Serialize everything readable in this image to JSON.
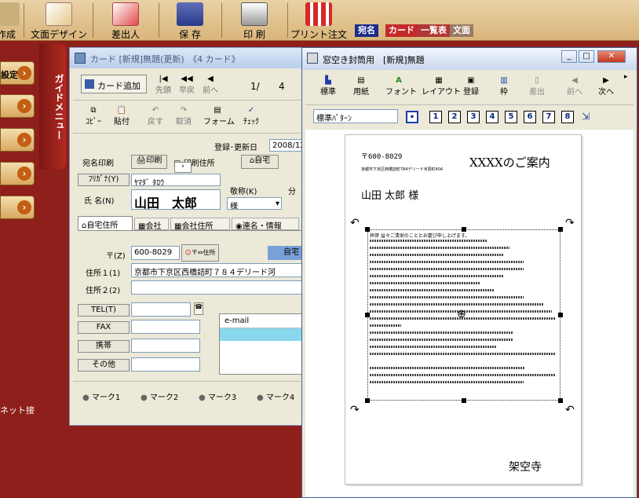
{
  "toolbar": {
    "items": [
      {
        "label": "作成",
        "icon": "create-icon"
      },
      {
        "label": "文面デザイン",
        "icon": "design-icon"
      },
      {
        "label": "差出人",
        "icon": "sender-icon"
      },
      {
        "label": "保 存",
        "icon": "save-icon"
      },
      {
        "label": "印 刷",
        "icon": "printer-icon"
      },
      {
        "label": "プリント注文",
        "icon": "print-order-icon"
      }
    ],
    "tabs": [
      "宛名",
      "カード",
      "一覧表",
      "文面"
    ]
  },
  "sidebar": {
    "items": [
      {
        "label": "設定"
      },
      {
        "label": ""
      },
      {
        "label": ""
      },
      {
        "label": ""
      },
      {
        "label": ""
      }
    ],
    "guide_label": "ガイドメニュー",
    "net_label": "ネット接"
  },
  "card_window": {
    "title": "カード [新規]無題(更新)　《4 カード》",
    "add_card": "カード追加",
    "nav": [
      "先頭",
      "早戻",
      "前へ"
    ],
    "page": "1/",
    "page_total": "4",
    "tools": [
      "ｺﾋﾟｰ",
      "貼付",
      "戻す",
      "取消",
      "フォーム",
      "ﾁｪｯｸ"
    ],
    "updated_label": "登録･更新日",
    "updated_value": "2008/12/",
    "print_label": "宛名印刷",
    "print_btn": "印刷",
    "print_addr_label": "印刷住所",
    "home_btn": "自宅",
    "furigana_label": "ﾌﾘｶﾞﾅ(Y)",
    "furigana_value": "ﾔﾏﾀﾞ ﾀﾛｳ",
    "honorific_label": "敬称(K)",
    "honorific_value": "様",
    "category_label": "分",
    "name_label": "氏 名(N)",
    "name_value": "山田　太郎",
    "tabs": [
      "自宅住所",
      "会社",
      "会社住所",
      "連名・情報"
    ],
    "zip_label": "〒(Z)",
    "zip_value": "600-8029",
    "zip_btn": "〒⇔住所",
    "home_tag": "自宅",
    "addr1_label": "住所１(1)",
    "addr1_value": "京都市下京区西橋詰町７８４デリード河",
    "addr2_label": "住所２(2)",
    "tel_label": "TEL(T)",
    "fax_label": "FAX",
    "mobile_label": "携帯",
    "other_label": "その他",
    "email_header": "e-mail",
    "marks": [
      "マーク1",
      "マーク2",
      "マーク3",
      "マーク4"
    ]
  },
  "envelope_window": {
    "title": "窓空き封筒用　[新規]無題",
    "tools": [
      "標準",
      "用紙",
      "フォント",
      "レイアウト",
      "登録",
      "枠",
      "差出",
      "前へ",
      "次へ"
    ],
    "pattern_value": "標準ﾊﾟﾀｰﾝ",
    "pattern_buttons": [
      "1",
      "2",
      "3",
      "4",
      "5",
      "6",
      "7",
      "8"
    ],
    "preview": {
      "zip": "〒600-8029",
      "addr_small": "京都市下京区西橋詰町784デリード河原町404",
      "heading": "XXXXのご案内",
      "recipient": "山田 太郎 様",
      "body_first": "拝啓 益々ご清栄のこととお慶び申し上げます。",
      "signature": "架空寺"
    }
  }
}
